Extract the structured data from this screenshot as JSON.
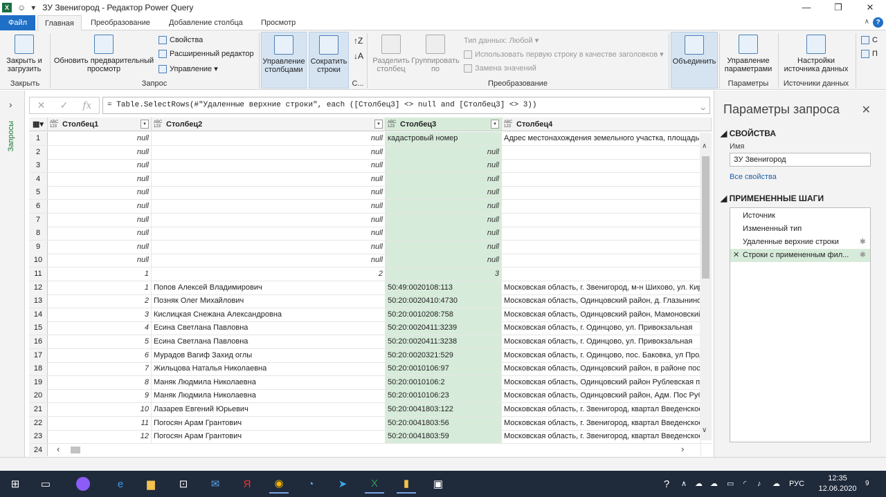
{
  "window": {
    "title": "ЗУ Звенигород - Редактор Power Query",
    "app_logo": "X",
    "minimize": "—",
    "restore": "❐",
    "close": "✕"
  },
  "tabs": [
    {
      "label": "Файл"
    },
    {
      "label": "Главная"
    },
    {
      "label": "Преобразование"
    },
    {
      "label": "Добавление столбца"
    },
    {
      "label": "Просмотр"
    }
  ],
  "help": "?",
  "ribbon": {
    "close_load": "Закрыть и загрузить",
    "refresh_preview": "Обновить предварительный просмотр",
    "properties": "Свойства",
    "advanced_editor": "Расширенный редактор",
    "manage": "Управление",
    "manage_columns": "Управление столбцами",
    "reduce_rows": "Сократить строки",
    "split_column": "Разделить столбец",
    "group_by": "Группировать по",
    "data_type": "Тип данных: Любой",
    "use_first_row": "Использовать первую строку в качестве заголовков",
    "replace_values": "Замена значений",
    "combine": "Объединить",
    "manage_params": "Управление параметрами",
    "source_settings": "Настройки источника данных",
    "groups": {
      "close": "Закрыть",
      "query": "Запрос",
      "sort": "С...",
      "transform": "Преобразование",
      "params": "Параметры",
      "datasources": "Источники данных"
    },
    "extra1": "С",
    "extra2": "П"
  },
  "leftnav": {
    "label": "Запросы"
  },
  "formula": {
    "text": "= Table.SelectRows(#\"Удаленные верхние строки\", each ([Столбец3] <> null and [Столбец3] <> 3))"
  },
  "columns": [
    {
      "type": "ABC 123",
      "name": "Столбец1"
    },
    {
      "type": "ABC 123",
      "name": "Столбец2"
    },
    {
      "type": "ABC 123",
      "name": "Столбец3"
    },
    {
      "type": "ABC 123",
      "name": "Столбец4"
    }
  ],
  "rows": [
    {
      "n": "1",
      "c1": "null",
      "c2": "null",
      "c3": "кадастровый номер",
      "c4": "Адрес местонахождения земельного участка, площадь"
    },
    {
      "n": "2",
      "c1": "null",
      "c2": "null",
      "c3": "null",
      "c4": ""
    },
    {
      "n": "3",
      "c1": "null",
      "c2": "null",
      "c3": "null",
      "c4": ""
    },
    {
      "n": "4",
      "c1": "null",
      "c2": "null",
      "c3": "null",
      "c4": ""
    },
    {
      "n": "5",
      "c1": "null",
      "c2": "null",
      "c3": "null",
      "c4": ""
    },
    {
      "n": "6",
      "c1": "null",
      "c2": "null",
      "c3": "null",
      "c4": ""
    },
    {
      "n": "7",
      "c1": "null",
      "c2": "null",
      "c3": "null",
      "c4": ""
    },
    {
      "n": "8",
      "c1": "null",
      "c2": "null",
      "c3": "null",
      "c4": ""
    },
    {
      "n": "9",
      "c1": "null",
      "c2": "null",
      "c3": "null",
      "c4": ""
    },
    {
      "n": "10",
      "c1": "null",
      "c2": "null",
      "c3": "null",
      "c4": ""
    },
    {
      "n": "11",
      "c1": "1",
      "c2": "2",
      "c3": "3",
      "c4": ""
    },
    {
      "n": "12",
      "c1": "1",
      "c2": "Попов Алексей Владимирович",
      "c3": "50:49:0020108:113",
      "c4": "Московская область, г. Звенигород, м-н Шихово, ул. Киров"
    },
    {
      "n": "13",
      "c1": "2",
      "c2": "Позняк Олег Михайлович",
      "c3": "50:20:0020410:4730",
      "c4": "Московская область, Одинцовский район, д. Глазынино"
    },
    {
      "n": "14",
      "c1": "3",
      "c2": "Кислицкая Снежана Александровна",
      "c3": "50:20:0010208:758",
      "c4": "Московская область, Одинцовский район, Мамоновский с."
    },
    {
      "n": "15",
      "c1": "4",
      "c2": "Есина Светлана Павловна",
      "c3": "50:20:0020411:3239",
      "c4": "Московская область, г. Одинцово, ул. Привокзальная"
    },
    {
      "n": "16",
      "c1": "5",
      "c2": "Есина Светлана Павловна",
      "c3": "50:20:0020411:3238",
      "c4": "Московская область, г. Одинцово, ул. Привокзальная"
    },
    {
      "n": "17",
      "c1": "6",
      "c2": "Мурадов Вагиф Захид оглы",
      "c3": "50:20:0020321:529",
      "c4": "Московская область, г. Одинцово, пос. Баковка, ул Пролета"
    },
    {
      "n": "18",
      "c1": "7",
      "c2": "Жильцова Наталья Николаевна",
      "c3": "50:20:0010106:97",
      "c4": "Московская область, Одинцовский район, в районе пос. Ру"
    },
    {
      "n": "19",
      "c1": "8",
      "c2": "Маняк Людмила Николаевна",
      "c3": "50:20:0010106:2",
      "c4": "Московская область, Одинцовский район Рублевская п\\а, п"
    },
    {
      "n": "20",
      "c1": "9",
      "c2": "Маняк Людмила Николаевна",
      "c3": "50:20:0010106:23",
      "c4": "Московская область, Одинцовский район, Адм. Пос Рублев"
    },
    {
      "n": "21",
      "c1": "10",
      "c2": "Лазарев Евгений Юрьевич",
      "c3": "50:20:0041803:122",
      "c4": "Московская область, г. Звенигород, квартал Введенское, у"
    },
    {
      "n": "22",
      "c1": "11",
      "c2": "Погосян Арам Грантович",
      "c3": "50:20:0041803:56",
      "c4": "Московская область, г. Звенигород, квартал Введенское, у"
    },
    {
      "n": "23",
      "c1": "12",
      "c2": "Погосян Арам Грантович",
      "c3": "50:20:0041803:59",
      "c4": "Московская область, г. Звенигород, квартал Введенское, у"
    },
    {
      "n": "24",
      "c1": "",
      "c2": "",
      "c3": "",
      "c4": ""
    }
  ],
  "right_pane": {
    "title": "Параметры запроса",
    "properties_header": "СВОЙСТВА",
    "name_label": "Имя",
    "name_value": "ЗУ Звенигород",
    "all_props": "Все свойства",
    "steps_header": "ПРИМЕНЕННЫЕ ШАГИ",
    "steps": [
      {
        "label": "Источник",
        "gear": false
      },
      {
        "label": "Измененный тип",
        "gear": false
      },
      {
        "label": "Удаленные верхние строки",
        "gear": true
      },
      {
        "label": "Строки с примененным фил...",
        "gear": true
      }
    ]
  },
  "taskbar": {
    "lang": "РУС",
    "time": "12:35",
    "date": "12.06.2020",
    "notif": "9"
  }
}
